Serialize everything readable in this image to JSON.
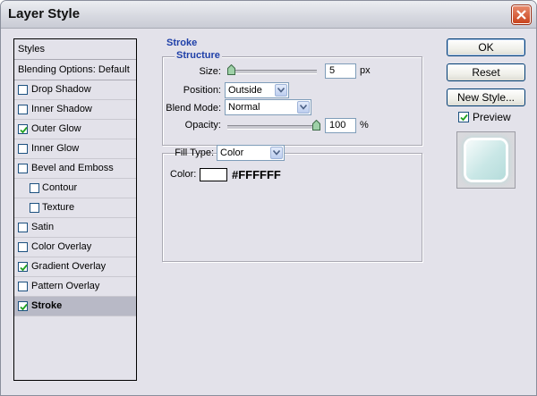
{
  "window": {
    "title": "Layer Style"
  },
  "styles": {
    "header": "Styles",
    "blending": "Blending Options: Default",
    "items": [
      {
        "label": "Drop Shadow",
        "checked": false
      },
      {
        "label": "Inner Shadow",
        "checked": false
      },
      {
        "label": "Outer Glow",
        "checked": true
      },
      {
        "label": "Inner Glow",
        "checked": false
      },
      {
        "label": "Bevel and Emboss",
        "checked": false
      },
      {
        "label": "Contour",
        "checked": false
      },
      {
        "label": "Texture",
        "checked": false
      },
      {
        "label": "Satin",
        "checked": false
      },
      {
        "label": "Color Overlay",
        "checked": false
      },
      {
        "label": "Gradient Overlay",
        "checked": true
      },
      {
        "label": "Pattern Overlay",
        "checked": false
      },
      {
        "label": "Stroke",
        "checked": true
      }
    ],
    "selected": "Stroke"
  },
  "stroke": {
    "title": "Stroke",
    "structure": {
      "title": "Structure",
      "size_label": "Size:",
      "size_value": "5",
      "size_unit": "px",
      "position_label": "Position:",
      "position_value": "Outside",
      "blend_label": "Blend Mode:",
      "blend_value": "Normal",
      "opacity_label": "Opacity:",
      "opacity_value": "100",
      "opacity_unit": "%"
    },
    "fill": {
      "type_label": "Fill Type:",
      "type_value": "Color",
      "color_label": "Color:",
      "color_value": "#FFFFFF"
    }
  },
  "buttons": {
    "ok": "OK",
    "reset": "Reset",
    "new_style": "New Style..."
  },
  "preview": {
    "label": "Preview",
    "checked": true
  },
  "colors": {
    "section_title": "#1e3fa8",
    "selected_row": "#b8b9c6",
    "dialog_bg": "#e3e2ea"
  }
}
